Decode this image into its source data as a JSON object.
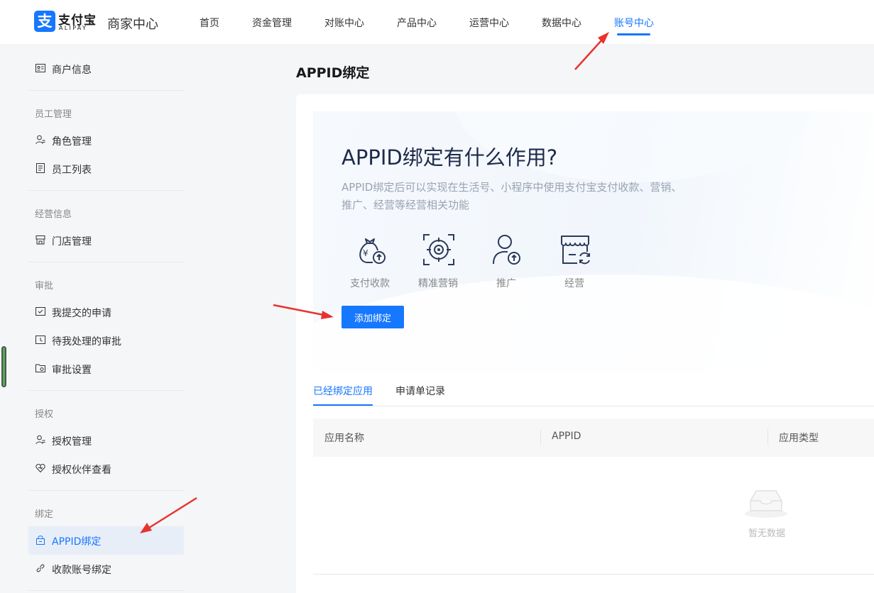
{
  "brand": {
    "logo_glyph": "支",
    "logo_cn": "支付宝",
    "logo_en": "ALIPAY",
    "app_title": "商家中心",
    "accent_color": "#1677ff"
  },
  "nav": {
    "items": [
      {
        "label": "首页"
      },
      {
        "label": "资金管理"
      },
      {
        "label": "对账中心"
      },
      {
        "label": "产品中心"
      },
      {
        "label": "运营中心"
      },
      {
        "label": "数据中心"
      },
      {
        "label": "账号中心",
        "active": true
      }
    ]
  },
  "sidebar": {
    "merchant_info": {
      "label": "商户信息",
      "icon": "id-card-icon"
    },
    "groups": [
      {
        "title": "员工管理",
        "items": [
          {
            "label": "角色管理",
            "icon": "user-edit-icon"
          },
          {
            "label": "员工列表",
            "icon": "list-icon"
          }
        ]
      },
      {
        "title": "经营信息",
        "items": [
          {
            "label": "门店管理",
            "icon": "store-icon"
          }
        ]
      },
      {
        "title": "审批",
        "items": [
          {
            "label": "我提交的申请",
            "icon": "inbox-check-icon"
          },
          {
            "label": "待我处理的审批",
            "icon": "inbox-pending-icon"
          },
          {
            "label": "审批设置",
            "icon": "folder-settings-icon"
          }
        ]
      },
      {
        "title": "授权",
        "items": [
          {
            "label": "授权管理",
            "icon": "user-edit-icon"
          },
          {
            "label": "授权伙伴查看",
            "icon": "heart-icon"
          }
        ]
      },
      {
        "title": "绑定",
        "items": [
          {
            "label": "APPID绑定",
            "icon": "lock-box-icon",
            "active": true
          },
          {
            "label": "收款账号绑定",
            "icon": "link-icon"
          }
        ]
      }
    ]
  },
  "main": {
    "page_title": "APPID绑定",
    "hero": {
      "title": "APPID绑定有什么作用?",
      "description": "APPID绑定后可以实现在生活号、小程序中使用支付宝支付收款、营销、推广、经营等经营相关功能",
      "features": [
        {
          "label": "支付收款",
          "icon": "money-bag-icon"
        },
        {
          "label": "精准营销",
          "icon": "target-icon"
        },
        {
          "label": "推广",
          "icon": "user-promote-icon"
        },
        {
          "label": "经营",
          "icon": "shop-refresh-icon"
        }
      ],
      "add_button": "添加绑定"
    },
    "tabs": [
      {
        "label": "已经绑定应用",
        "active": true
      },
      {
        "label": "申请单记录"
      }
    ],
    "table": {
      "columns": [
        "应用名称",
        "APPID",
        "应用类型"
      ],
      "empty_text": "暂无数据"
    }
  }
}
